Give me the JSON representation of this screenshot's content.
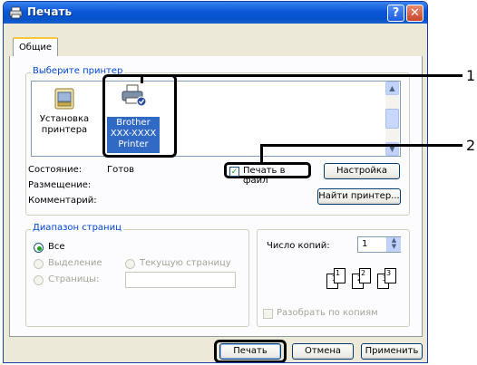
{
  "dialog": {
    "title": "Печать",
    "help_glyph": "?",
    "close_glyph": "✕"
  },
  "tabs": [
    {
      "label": "Общие"
    }
  ],
  "printer_group": {
    "legend": "Выберите принтер",
    "printers": [
      {
        "label_line1": "Установка",
        "label_line2": "принтера"
      },
      {
        "label_line1": "Brother",
        "label_line2": "XXX-XXXX",
        "label_line3": "Printer"
      }
    ]
  },
  "status": {
    "state_label": "Состояние:",
    "state_value": "Готов",
    "location_label": "Размещение:",
    "comment_label": "Комментарий:"
  },
  "print_to_file": {
    "label": "Печать в файл",
    "checked": true
  },
  "buttons": {
    "settings": "Настройка",
    "find_printer": "Найти принтер...",
    "print": "Печать",
    "cancel": "Отмена",
    "apply": "Применить"
  },
  "page_range": {
    "legend": "Диапазон страниц",
    "all": "Все",
    "selection": "Выделение",
    "current_page": "Текущую страницу",
    "pages": "Страницы:",
    "selected": "all"
  },
  "copies": {
    "label": "Число копий:",
    "value": "1",
    "collate_label": "Разобрать по копиям",
    "collate_checked": false,
    "sheets": [
      "1",
      "1",
      "2",
      "2",
      "3",
      "3"
    ]
  },
  "callouts": [
    "1",
    "2"
  ],
  "colors": {
    "accent_green": "#21a121",
    "title_blue": "#0a56d8",
    "legend_blue": "#0046d5"
  }
}
